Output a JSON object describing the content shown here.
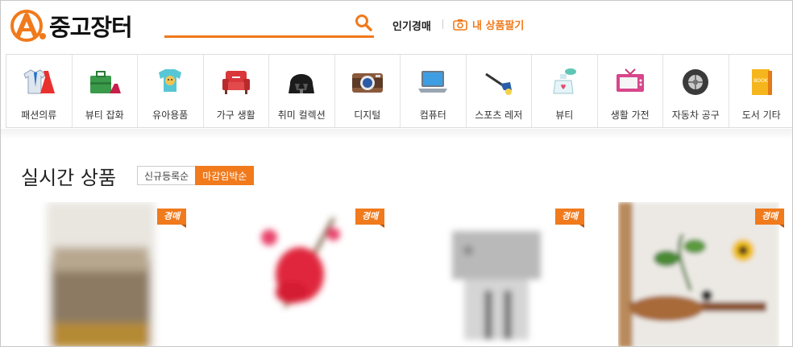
{
  "header": {
    "logo_text": "중고장터",
    "search_placeholder": "",
    "hot_auction_label": "인기경매",
    "sell_label": "내 상품팔기"
  },
  "categories": [
    {
      "label": "패션의류",
      "icon": "clothes-icon"
    },
    {
      "label": "뷰티 잡화",
      "icon": "bag-shoes-icon"
    },
    {
      "label": "유아용품",
      "icon": "baby-onesie-icon"
    },
    {
      "label": "가구 생활",
      "icon": "sofa-icon"
    },
    {
      "label": "취미 컬렉션",
      "icon": "helmet-icon"
    },
    {
      "label": "디지털",
      "icon": "camera-icon"
    },
    {
      "label": "컴퓨터",
      "icon": "laptop-icon"
    },
    {
      "label": "스포츠 레저",
      "icon": "golf-icon"
    },
    {
      "label": "뷰티",
      "icon": "perfume-icon"
    },
    {
      "label": "생활 가전",
      "icon": "tv-icon"
    },
    {
      "label": "자동차 공구",
      "icon": "tire-icon"
    },
    {
      "label": "도서 기타",
      "icon": "book-icon",
      "icon_text": "BOOK"
    }
  ],
  "section": {
    "title": "실시간 상품",
    "sort_options": [
      "신규등록순",
      "마감임박순"
    ],
    "active_sort": "마감임박순"
  },
  "products": [
    {
      "badge": "경매",
      "image": "blurred bag photo"
    },
    {
      "badge": "경매",
      "image": "blurred red flower ornament photo"
    },
    {
      "badge": "경매",
      "image": "blurred metal hardware photo"
    },
    {
      "badge": "경매",
      "image": "blurred shelf with plants photo"
    }
  ],
  "colors": {
    "accent": "#f07a1c"
  }
}
